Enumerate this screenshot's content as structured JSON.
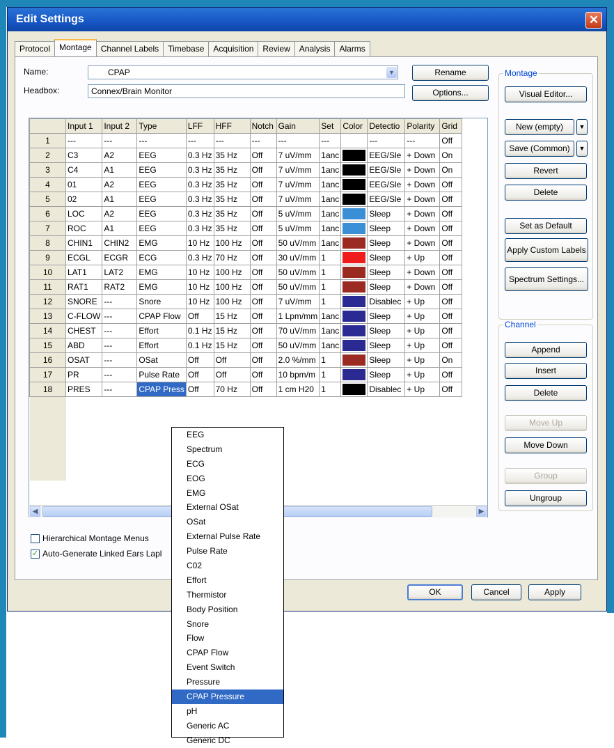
{
  "window": {
    "title": "Edit Settings",
    "close_symbol": "✕"
  },
  "tabs": [
    "Protocol",
    "Montage",
    "Channel Labels",
    "Timebase",
    "Acquisition",
    "Review",
    "Analysis",
    "Alarms"
  ],
  "active_tab": "Montage",
  "name_field": {
    "label": "Name:",
    "value": "CPAP"
  },
  "headbox_field": {
    "label": "Headbox:",
    "value": "Connex/Brain Monitor"
  },
  "buttons": {
    "rename": "Rename",
    "options": "Options...",
    "ok": "OK",
    "cancel": "Cancel",
    "apply": "Apply"
  },
  "montage_group": {
    "title": "Montage",
    "visual_editor": "Visual Editor...",
    "new": "New (empty)",
    "save": "Save (Common)",
    "revert": "Revert",
    "delete": "Delete",
    "set_default": "Set as Default",
    "apply_custom_labels": "Apply Custom Labels",
    "spectrum_settings": "Spectrum Settings..."
  },
  "channel_group": {
    "title": "Channel",
    "append": "Append",
    "insert": "Insert",
    "delete": "Delete",
    "move_up": "Move Up",
    "move_down": "Move Down",
    "group": "Group",
    "ungroup": "Ungroup"
  },
  "grid": {
    "columns": [
      "",
      "Input 1",
      "Input 2",
      "Type",
      "LFF",
      "HFF",
      "Notch",
      "Gain",
      "Set",
      "Color",
      "Detectio",
      "Polarity",
      "Grid"
    ],
    "rows": [
      {
        "n": "1",
        "in1": "---",
        "in2": "---",
        "type": "---",
        "lff": "---",
        "hff": "---",
        "notch": "---",
        "gain": "---",
        "set": "---",
        "color": "",
        "det": "---",
        "pol": "---",
        "grid": "Off"
      },
      {
        "n": "2",
        "in1": "C3",
        "in2": "A2",
        "type": "EEG",
        "lff": "0.3 Hz",
        "hff": "35 Hz",
        "notch": "Off",
        "gain": "7 uV/mm",
        "set": "1anc",
        "color": "#000000",
        "det": "EEG/Sle",
        "pol": "+ Down",
        "grid": "On"
      },
      {
        "n": "3",
        "in1": "C4",
        "in2": "A1",
        "type": "EEG",
        "lff": "0.3 Hz",
        "hff": "35 Hz",
        "notch": "Off",
        "gain": "7 uV/mm",
        "set": "1anc",
        "color": "#000000",
        "det": "EEG/Sle",
        "pol": "+ Down",
        "grid": "On"
      },
      {
        "n": "4",
        "in1": "01",
        "in2": "A2",
        "type": "EEG",
        "lff": "0.3 Hz",
        "hff": "35 Hz",
        "notch": "Off",
        "gain": "7 uV/mm",
        "set": "1anc",
        "color": "#000000",
        "det": "EEG/Sle",
        "pol": "+ Down",
        "grid": "Off"
      },
      {
        "n": "5",
        "in1": "02",
        "in2": "A1",
        "type": "EEG",
        "lff": "0.3 Hz",
        "hff": "35 Hz",
        "notch": "Off",
        "gain": "7 uV/mm",
        "set": "1anc",
        "color": "#000000",
        "det": "EEG/Sle",
        "pol": "+ Down",
        "grid": "Off"
      },
      {
        "n": "6",
        "in1": "LOC",
        "in2": "A2",
        "type": "EEG",
        "lff": "0.3 Hz",
        "hff": "35 Hz",
        "notch": "Off",
        "gain": "5 uV/mm",
        "set": "1anc",
        "color": "#3a8fd6",
        "det": "Sleep",
        "pol": "+ Down",
        "grid": "Off"
      },
      {
        "n": "7",
        "in1": "ROC",
        "in2": "A1",
        "type": "EEG",
        "lff": "0.3 Hz",
        "hff": "35 Hz",
        "notch": "Off",
        "gain": "5 uV/mm",
        "set": "1anc",
        "color": "#3a8fd6",
        "det": "Sleep",
        "pol": "+ Down",
        "grid": "Off"
      },
      {
        "n": "8",
        "in1": "CHIN1",
        "in2": "CHIN2",
        "type": "EMG",
        "lff": "10 Hz",
        "hff": "100 Hz",
        "notch": "Off",
        "gain": "50 uV/mm",
        "set": "1anc",
        "color": "#9b2b22",
        "det": "Sleep",
        "pol": "+ Down",
        "grid": "Off"
      },
      {
        "n": "9",
        "in1": "ECGL",
        "in2": "ECGR",
        "type": "ECG",
        "lff": "0.3 Hz",
        "hff": "70 Hz",
        "notch": "Off",
        "gain": "30 uV/mm",
        "set": "1",
        "color": "#ee1c1c",
        "det": "Sleep",
        "pol": "+ Up",
        "grid": "Off"
      },
      {
        "n": "10",
        "in1": "LAT1",
        "in2": "LAT2",
        "type": "EMG",
        "lff": "10 Hz",
        "hff": "100 Hz",
        "notch": "Off",
        "gain": "50 uV/mm",
        "set": "1",
        "color": "#9b2b22",
        "det": "Sleep",
        "pol": "+ Down",
        "grid": "Off"
      },
      {
        "n": "11",
        "in1": "RAT1",
        "in2": "RAT2",
        "type": "EMG",
        "lff": "10 Hz",
        "hff": "100 Hz",
        "notch": "Off",
        "gain": "50 uV/mm",
        "set": "1",
        "color": "#9b2b22",
        "det": "Sleep",
        "pol": "+ Down",
        "grid": "Off"
      },
      {
        "n": "12",
        "in1": "SNORE",
        "in2": "---",
        "type": "Snore",
        "lff": "10 Hz",
        "hff": "100 Hz",
        "notch": "Off",
        "gain": "7 uV/mm",
        "set": "1",
        "color": "#2a2a92",
        "det": "Disablec",
        "pol": "+ Up",
        "grid": "Off"
      },
      {
        "n": "13",
        "in1": "C-FLOW",
        "in2": "---",
        "type": "CPAP Flow",
        "lff": "Off",
        "hff": "15 Hz",
        "notch": "Off",
        "gain": "1 Lpm/mm",
        "set": "1anc",
        "color": "#2a2a92",
        "det": "Sleep",
        "pol": "+ Up",
        "grid": "Off"
      },
      {
        "n": "14",
        "in1": "CHEST",
        "in2": "---",
        "type": "Effort",
        "lff": "0.1 Hz",
        "hff": "15 Hz",
        "notch": "Off",
        "gain": "70 uV/mm",
        "set": "1anc",
        "color": "#2a2a92",
        "det": "Sleep",
        "pol": "+ Up",
        "grid": "Off"
      },
      {
        "n": "15",
        "in1": "ABD",
        "in2": "---",
        "type": "Effort",
        "lff": "0.1 Hz",
        "hff": "15 Hz",
        "notch": "Off",
        "gain": "50 uV/mm",
        "set": "1anc",
        "color": "#2a2a92",
        "det": "Sleep",
        "pol": "+ Up",
        "grid": "Off"
      },
      {
        "n": "16",
        "in1": "OSAT",
        "in2": "---",
        "type": "OSat",
        "lff": "Off",
        "hff": "Off",
        "notch": "Off",
        "gain": "2.0 %/mm",
        "set": "1",
        "color": "#9b2b22",
        "det": "Sleep",
        "pol": "+ Up",
        "grid": "On"
      },
      {
        "n": "17",
        "in1": "PR",
        "in2": "---",
        "type": "Pulse Rate",
        "lff": "Off",
        "hff": "Off",
        "notch": "Off",
        "gain": "10 bpm/m",
        "set": "1",
        "color": "#2a2a92",
        "det": "Sleep",
        "pol": "+ Up",
        "grid": "Off"
      },
      {
        "n": "18",
        "in1": "PRES",
        "in2": "---",
        "type": "CPAP Press",
        "lff": "Off",
        "hff": "70 Hz",
        "notch": "Off",
        "gain": "1 cm H20",
        "set": "1",
        "color": "#000000",
        "det": "Disablec",
        "pol": "+ Up",
        "grid": "Off"
      }
    ]
  },
  "checkboxes": [
    {
      "label": "Hierarchical Montage Menus",
      "checked": false,
      "mark": ""
    },
    {
      "label": "Auto-Generate Linked Ears Lapl",
      "checked": true,
      "mark": "✓"
    }
  ],
  "type_dropdown": {
    "items": [
      "EEG",
      "Spectrum",
      "ECG",
      "EOG",
      "EMG",
      "External OSat",
      "OSat",
      "External Pulse Rate",
      "Pulse Rate",
      "C02",
      "Effort",
      "Thermistor",
      "Body Position",
      "Snore",
      "Flow",
      "CPAP Flow",
      "Event Switch",
      "Pressure",
      "CPAP Pressure",
      "pH",
      "Generic AC",
      "Generic DC"
    ],
    "selected": "CPAP Pressure"
  },
  "icons": {
    "combo_arrow": "chevron-down-icon",
    "scroll_left": "arrow-left-icon",
    "scroll_right": "arrow-right-icon",
    "split_arrow": "chevron-down-icon"
  }
}
